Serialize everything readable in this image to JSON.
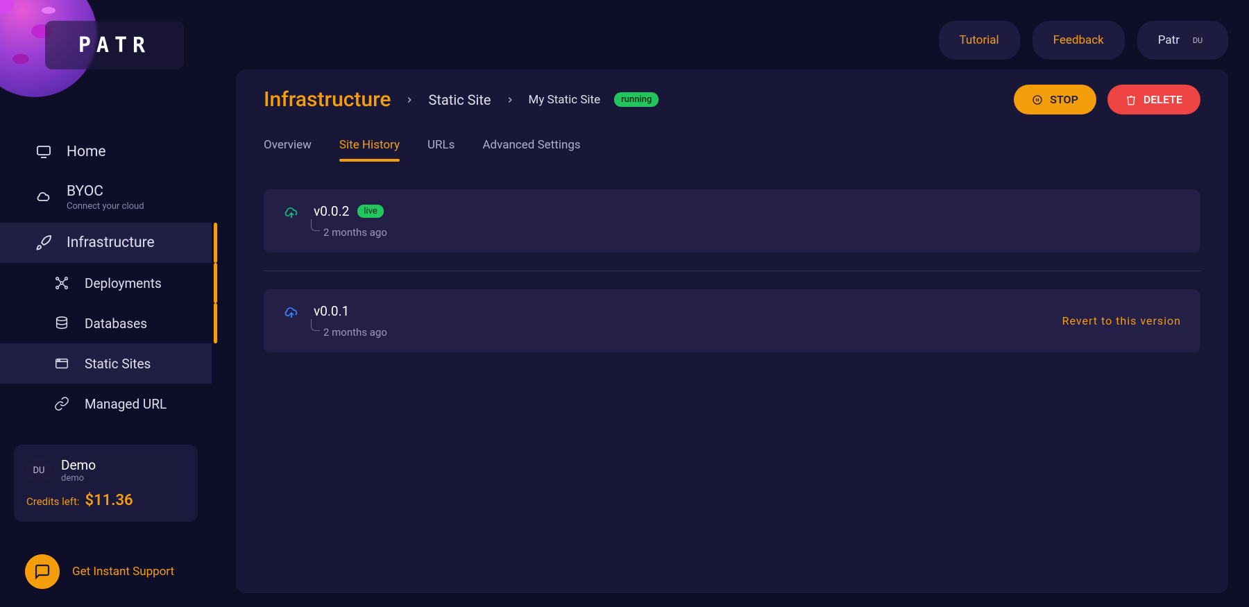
{
  "brand": "PATR",
  "header": {
    "tutorial": "Tutorial",
    "feedback": "Feedback",
    "account_name": "Patr",
    "account_initials": "DU"
  },
  "sidebar": {
    "items": [
      {
        "label": "Home"
      },
      {
        "label": "BYOC",
        "sub": "Connect your cloud"
      },
      {
        "label": "Infrastructure"
      },
      {
        "label": "Deployments"
      },
      {
        "label": "Databases"
      },
      {
        "label": "Static Sites"
      },
      {
        "label": "Managed URL"
      }
    ]
  },
  "user_card": {
    "initials": "DU",
    "name": "Demo",
    "username": "demo",
    "credits_label": "Credits left:",
    "credits_value": "$11.36"
  },
  "support": "Get Instant Support",
  "breadcrumb": {
    "root": "Infrastructure",
    "level1": "Static Site",
    "level2": "My Static Site",
    "status": "running"
  },
  "actions": {
    "stop": "STOP",
    "delete": "DELETE"
  },
  "tabs": [
    {
      "label": "Overview"
    },
    {
      "label": "Site History"
    },
    {
      "label": "URLs"
    },
    {
      "label": "Advanced Settings"
    }
  ],
  "history": [
    {
      "version": "v0.0.2",
      "live": true,
      "live_label": "live",
      "time": "2 months ago"
    },
    {
      "version": "v0.0.1",
      "live": false,
      "time": "2 months ago",
      "revert": "Revert to this version"
    }
  ]
}
